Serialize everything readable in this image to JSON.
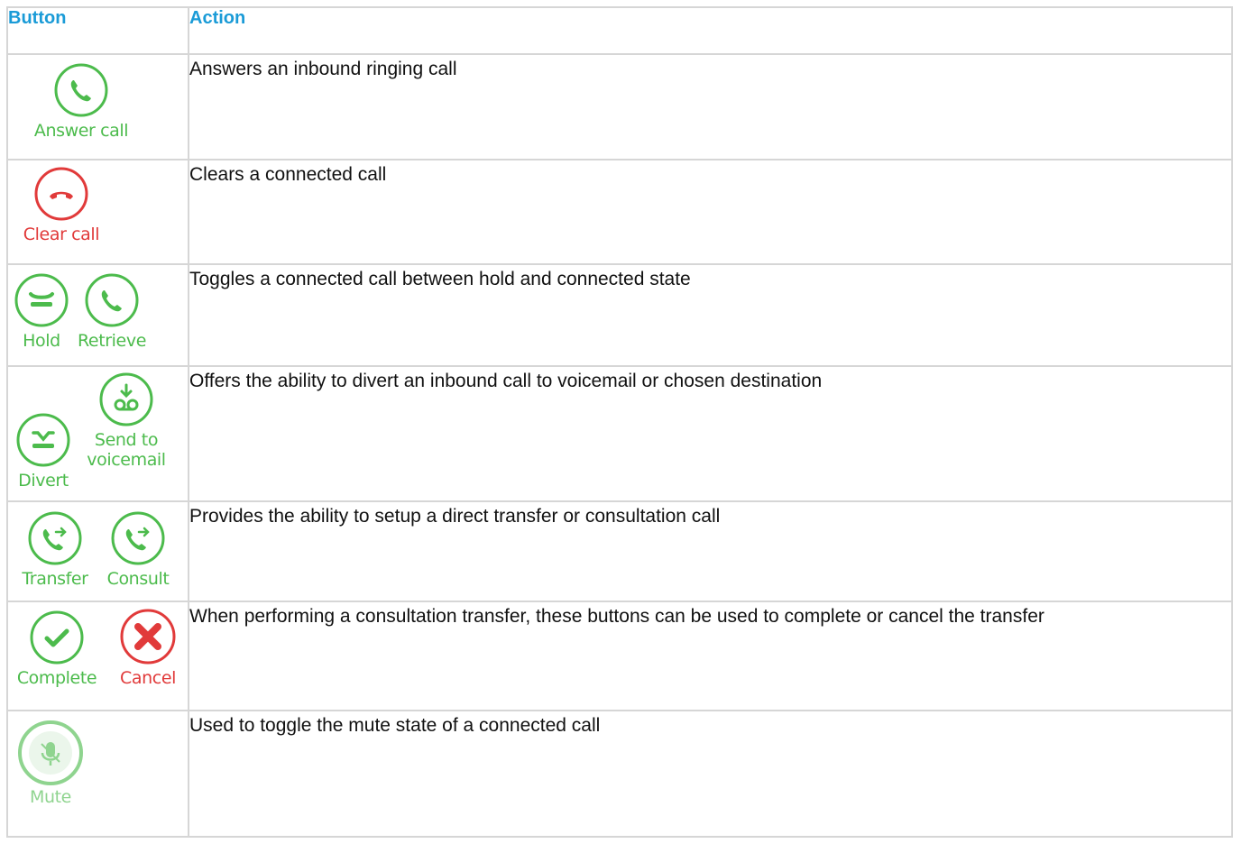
{
  "table": {
    "headers": {
      "button": "Button",
      "action": "Action"
    },
    "rows": [
      {
        "buttons": [
          {
            "label": "Answer call",
            "icon": "phone-icon",
            "color": "#4cbb4c"
          }
        ],
        "action": "Answers an inbound ringing call"
      },
      {
        "buttons": [
          {
            "label": "Clear call",
            "icon": "hangup-icon",
            "color": "#e13a3a"
          }
        ],
        "action": "Clears a connected call"
      },
      {
        "buttons": [
          {
            "label": "Hold",
            "icon": "hold-icon",
            "color": "#4cbb4c"
          },
          {
            "label": "Retrieve",
            "icon": "phone-icon",
            "color": "#4cbb4c"
          }
        ],
        "action": "Toggles a connected call between hold and connected state"
      },
      {
        "buttons": [
          {
            "label": "Divert",
            "icon": "divert-icon",
            "color": "#4cbb4c"
          },
          {
            "label_line1": "Send to",
            "label_line2": "voicemail",
            "icon": "voicemail-icon",
            "color": "#4cbb4c"
          }
        ],
        "action": "Offers the ability to divert an inbound call to voicemail or chosen destination"
      },
      {
        "buttons": [
          {
            "label": "Transfer",
            "icon": "transfer-icon",
            "color": "#4cbb4c"
          },
          {
            "label": "Consult",
            "icon": "transfer-icon",
            "color": "#4cbb4c"
          }
        ],
        "action": "Provides the ability to setup a direct transfer or consultation call"
      },
      {
        "buttons": [
          {
            "label": "Complete",
            "icon": "check-icon",
            "color": "#4cbb4c"
          },
          {
            "label": "Cancel",
            "icon": "cancel-x-icon",
            "color": "#e13a3a"
          }
        ],
        "action": "When performing a consultation transfer, these buttons can be used to complete or cancel the transfer"
      },
      {
        "buttons": [
          {
            "label": "Mute",
            "icon": "microphone-mute-icon",
            "color": "#4cbb4c"
          }
        ],
        "action": "Used to toggle the mute state of a connected call"
      }
    ]
  }
}
